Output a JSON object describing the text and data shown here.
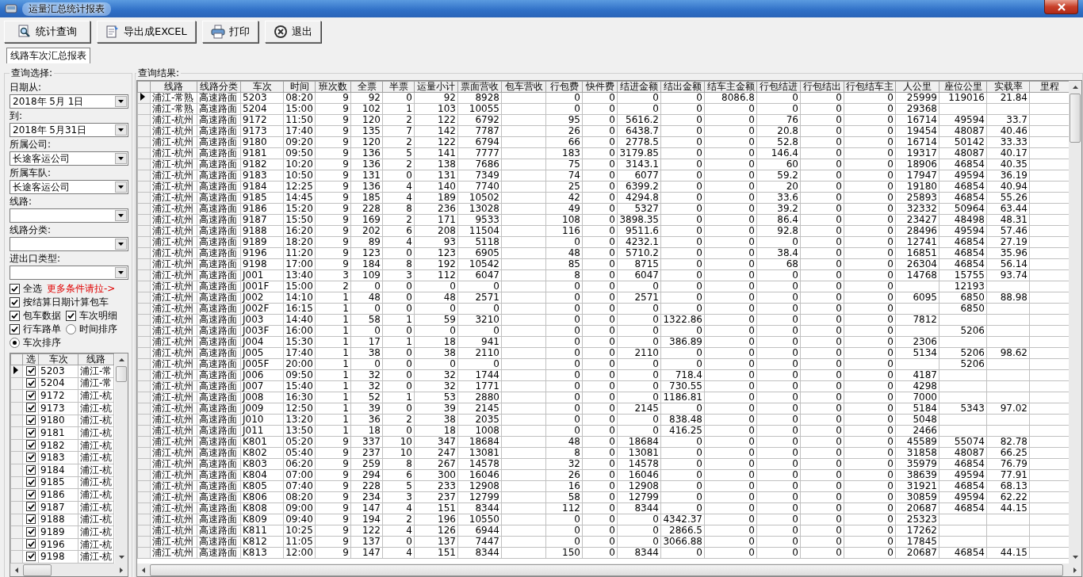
{
  "window": {
    "title": "运量汇总统计报表"
  },
  "toolbar": [
    {
      "kind": "query",
      "label": "统计查询"
    },
    {
      "kind": "export",
      "label": "导出成EXCEL"
    },
    {
      "kind": "print",
      "label": "打印"
    },
    {
      "kind": "exit",
      "label": "退出"
    }
  ],
  "tabs": [
    {
      "label": "线路车次汇总报表",
      "selected": true
    }
  ],
  "query_panel": {
    "title": "查询选择:",
    "fields": [
      {
        "label": "日期从:",
        "value": "2018年 5月 1日"
      },
      {
        "label": "到:",
        "value": "2018年 5月31日"
      },
      {
        "label": "所属公司:",
        "value": "长途客运公司"
      },
      {
        "label": "所属车队:",
        "value": "长途客运公司"
      },
      {
        "label": "线路:"
      },
      {
        "label": "线路分类:"
      },
      {
        "label": "进出口类型:"
      }
    ],
    "option_rows": [
      [
        {
          "kind": "checkbox",
          "label": "全选",
          "checked": true
        },
        {
          "kind": "link",
          "label": "更多条件请拉->"
        }
      ],
      [
        {
          "kind": "checkbox",
          "label": "按结算日期计算包车",
          "checked": true
        }
      ],
      [
        {
          "kind": "checkbox",
          "label": "包车数据",
          "checked": true
        },
        {
          "kind": "checkbox",
          "label": "车次明细",
          "checked": true
        }
      ],
      [
        {
          "kind": "checkbox",
          "label": "行车路单",
          "checked": true
        },
        {
          "kind": "radio",
          "label": "时间排序",
          "selected": false
        }
      ],
      [
        {
          "kind": "radio",
          "label": "车次排序",
          "selected": true
        }
      ]
    ],
    "list": {
      "columns": [
        "选",
        "车次",
        "线路"
      ],
      "rows": [
        {
          "selected": true,
          "checked": true,
          "train": "5203",
          "route": "浦江-常"
        },
        {
          "selected": false,
          "checked": true,
          "train": "5204",
          "route": "浦江-常"
        },
        {
          "selected": false,
          "checked": true,
          "train": "9172",
          "route": "浦江-杭"
        },
        {
          "selected": false,
          "checked": true,
          "train": "9173",
          "route": "浦江-杭"
        },
        {
          "selected": false,
          "checked": true,
          "train": "9180",
          "route": "浦江-杭"
        },
        {
          "selected": false,
          "checked": true,
          "train": "9181",
          "route": "浦江-杭"
        },
        {
          "selected": false,
          "checked": true,
          "train": "9182",
          "route": "浦江-杭"
        },
        {
          "selected": false,
          "checked": true,
          "train": "9183",
          "route": "浦江-杭"
        },
        {
          "selected": false,
          "checked": true,
          "train": "9184",
          "route": "浦江-杭"
        },
        {
          "selected": false,
          "checked": true,
          "train": "9185",
          "route": "浦江-杭"
        },
        {
          "selected": false,
          "checked": true,
          "train": "9186",
          "route": "浦江-杭"
        },
        {
          "selected": false,
          "checked": true,
          "train": "9187",
          "route": "浦江-杭"
        },
        {
          "selected": false,
          "checked": true,
          "train": "9188",
          "route": "浦江-杭"
        },
        {
          "selected": false,
          "checked": true,
          "train": "9189",
          "route": "浦江-杭"
        },
        {
          "selected": false,
          "checked": true,
          "train": "9196",
          "route": "浦江-杭"
        },
        {
          "selected": false,
          "checked": true,
          "train": "9198",
          "route": "浦江-杭"
        }
      ]
    }
  },
  "results": {
    "title": "查询结果:",
    "columns": [
      {
        "label": "线路",
        "kind": "text"
      },
      {
        "label": "线路分类",
        "kind": "text"
      },
      {
        "label": "车次",
        "kind": "text"
      },
      {
        "label": "时间",
        "kind": "time"
      },
      {
        "label": "班次数",
        "kind": "number"
      },
      {
        "label": "全票",
        "kind": "number"
      },
      {
        "label": "半票",
        "kind": "number"
      },
      {
        "label": "运量小计",
        "kind": "number"
      },
      {
        "label": "票面营收",
        "kind": "number"
      },
      {
        "label": "包车营收"
      },
      {
        "label": "行包费",
        "kind": "number"
      },
      {
        "label": "快件费",
        "kind": "number"
      },
      {
        "label": "结进金额",
        "kind": "number"
      },
      {
        "label": "结出金额",
        "kind": "number"
      },
      {
        "label": "结车主金额",
        "kind": "number"
      },
      {
        "label": "行包结进",
        "kind": "number"
      },
      {
        "label": "行包结出",
        "kind": "number"
      },
      {
        "label": "行包结车主",
        "kind": "number"
      },
      {
        "label": "人公里",
        "kind": "number"
      },
      {
        "label": "座位公里",
        "kind": "number"
      },
      {
        "label": "实载率",
        "kind": "number"
      },
      {
        "label": "里程"
      }
    ],
    "rows": [
      {
        "selected": true,
        "cells": [
          "浦江-常熟",
          "高速路面",
          "5203",
          "08:20",
          "9",
          "92",
          "0",
          "92",
          "8928",
          "",
          "0",
          "0",
          "0",
          "0",
          "8086.8",
          "0",
          "0",
          "0",
          "25999",
          "119016",
          "21.84",
          ""
        ]
      },
      {
        "selected": false,
        "cells": [
          "浦江-常熟",
          "高速路面",
          "5204",
          "15:00",
          "9",
          "102",
          "1",
          "103",
          "10055",
          "",
          "0",
          "0",
          "0",
          "0",
          "0",
          "0",
          "0",
          "0",
          "29368",
          "",
          "",
          ""
        ]
      },
      {
        "selected": false,
        "cells": [
          "浦江-杭州",
          "高速路面",
          "9172",
          "11:50",
          "9",
          "120",
          "2",
          "122",
          "6792",
          "",
          "95",
          "0",
          "5616.2",
          "0",
          "0",
          "76",
          "0",
          "0",
          "16714",
          "49594",
          "33.7",
          ""
        ]
      },
      {
        "selected": false,
        "cells": [
          "浦江-杭州",
          "高速路面",
          "9173",
          "17:40",
          "9",
          "135",
          "7",
          "142",
          "7787",
          "",
          "26",
          "0",
          "6438.7",
          "0",
          "0",
          "20.8",
          "0",
          "0",
          "19454",
          "48087",
          "40.46",
          ""
        ]
      },
      {
        "selected": false,
        "cells": [
          "浦江-杭州",
          "高速路面",
          "9180",
          "09:20",
          "9",
          "120",
          "2",
          "122",
          "6794",
          "",
          "66",
          "0",
          "2778.5",
          "0",
          "0",
          "52.8",
          "0",
          "0",
          "16714",
          "50142",
          "33.33",
          ""
        ]
      },
      {
        "selected": false,
        "cells": [
          "浦江-杭州",
          "高速路面",
          "9181",
          "09:50",
          "9",
          "136",
          "5",
          "141",
          "7777",
          "",
          "183",
          "0",
          "3179.85",
          "0",
          "0",
          "146.4",
          "0",
          "0",
          "19317",
          "48087",
          "40.17",
          ""
        ]
      },
      {
        "selected": false,
        "cells": [
          "浦江-杭州",
          "高速路面",
          "9182",
          "10:20",
          "9",
          "136",
          "2",
          "138",
          "7686",
          "",
          "75",
          "0",
          "3143.1",
          "0",
          "0",
          "60",
          "0",
          "0",
          "18906",
          "46854",
          "40.35",
          ""
        ]
      },
      {
        "selected": false,
        "cells": [
          "浦江-杭州",
          "高速路面",
          "9183",
          "10:50",
          "9",
          "131",
          "0",
          "131",
          "7349",
          "",
          "74",
          "0",
          "6077",
          "0",
          "0",
          "59.2",
          "0",
          "0",
          "17947",
          "49594",
          "36.19",
          ""
        ]
      },
      {
        "selected": false,
        "cells": [
          "浦江-杭州",
          "高速路面",
          "9184",
          "12:25",
          "9",
          "136",
          "4",
          "140",
          "7740",
          "",
          "25",
          "0",
          "6399.2",
          "0",
          "0",
          "20",
          "0",
          "0",
          "19180",
          "46854",
          "40.94",
          ""
        ]
      },
      {
        "selected": false,
        "cells": [
          "浦江-杭州",
          "高速路面",
          "9185",
          "14:45",
          "9",
          "185",
          "4",
          "189",
          "10502",
          "",
          "42",
          "0",
          "4294.8",
          "0",
          "0",
          "33.6",
          "0",
          "0",
          "25893",
          "46854",
          "55.26",
          ""
        ]
      },
      {
        "selected": false,
        "cells": [
          "浦江-杭州",
          "高速路面",
          "9186",
          "15:20",
          "9",
          "228",
          "8",
          "236",
          "13028",
          "",
          "49",
          "0",
          "5327",
          "0",
          "0",
          "39.2",
          "0",
          "0",
          "32332",
          "50964",
          "63.44",
          ""
        ]
      },
      {
        "selected": false,
        "cells": [
          "浦江-杭州",
          "高速路面",
          "9187",
          "15:50",
          "9",
          "169",
          "2",
          "171",
          "9533",
          "",
          "108",
          "0",
          "3898.35",
          "0",
          "0",
          "86.4",
          "0",
          "0",
          "23427",
          "48498",
          "48.31",
          ""
        ]
      },
      {
        "selected": false,
        "cells": [
          "浦江-杭州",
          "高速路面",
          "9188",
          "16:20",
          "9",
          "202",
          "6",
          "208",
          "11504",
          "",
          "116",
          "0",
          "9511.6",
          "0",
          "0",
          "92.8",
          "0",
          "0",
          "28496",
          "49594",
          "57.46",
          ""
        ]
      },
      {
        "selected": false,
        "cells": [
          "浦江-杭州",
          "高速路面",
          "9189",
          "18:20",
          "9",
          "89",
          "4",
          "93",
          "5118",
          "",
          "0",
          "0",
          "4232.1",
          "0",
          "0",
          "0",
          "0",
          "0",
          "12741",
          "46854",
          "27.19",
          ""
        ]
      },
      {
        "selected": false,
        "cells": [
          "浦江-杭州",
          "高速路面",
          "9196",
          "11:20",
          "9",
          "123",
          "0",
          "123",
          "6905",
          "",
          "48",
          "0",
          "5710.2",
          "0",
          "0",
          "38.4",
          "0",
          "0",
          "16851",
          "46854",
          "35.96",
          ""
        ]
      },
      {
        "selected": false,
        "cells": [
          "浦江-杭州",
          "高速路面",
          "9198",
          "17:00",
          "9",
          "184",
          "8",
          "192",
          "10542",
          "",
          "85",
          "0",
          "8715",
          "0",
          "0",
          "68",
          "0",
          "0",
          "26304",
          "46854",
          "56.14",
          ""
        ]
      },
      {
        "selected": false,
        "cells": [
          "浦江-杭州",
          "高速路面",
          "J001",
          "13:40",
          "3",
          "109",
          "3",
          "112",
          "6047",
          "",
          "8",
          "0",
          "6047",
          "0",
          "0",
          "0",
          "0",
          "0",
          "14768",
          "15755",
          "93.74",
          ""
        ]
      },
      {
        "selected": false,
        "cells": [
          "浦江-杭州",
          "高速路面",
          "J001F",
          "15:00",
          "2",
          "0",
          "0",
          "0",
          "0",
          "",
          "0",
          "0",
          "0",
          "0",
          "0",
          "0",
          "0",
          "0",
          "",
          "12193",
          "",
          ""
        ]
      },
      {
        "selected": false,
        "cells": [
          "浦江-杭州",
          "高速路面",
          "J002",
          "14:10",
          "1",
          "48",
          "0",
          "48",
          "2571",
          "",
          "0",
          "0",
          "2571",
          "0",
          "0",
          "0",
          "0",
          "0",
          "6095",
          "6850",
          "88.98",
          ""
        ]
      },
      {
        "selected": false,
        "cells": [
          "浦江-杭州",
          "高速路面",
          "J002F",
          "16:15",
          "1",
          "0",
          "0",
          "0",
          "0",
          "",
          "0",
          "0",
          "0",
          "0",
          "0",
          "0",
          "0",
          "0",
          "",
          "6850",
          "",
          ""
        ]
      },
      {
        "selected": false,
        "cells": [
          "浦江-杭州",
          "高速路面",
          "J003",
          "14:40",
          "1",
          "58",
          "1",
          "59",
          "3210",
          "",
          "0",
          "0",
          "0",
          "1322.86",
          "0",
          "0",
          "0",
          "0",
          "7812",
          "",
          "",
          ""
        ]
      },
      {
        "selected": false,
        "cells": [
          "浦江-杭州",
          "高速路面",
          "J003F",
          "16:00",
          "1",
          "0",
          "0",
          "0",
          "0",
          "",
          "0",
          "0",
          "0",
          "0",
          "0",
          "0",
          "0",
          "0",
          "",
          "5206",
          "",
          ""
        ]
      },
      {
        "selected": false,
        "cells": [
          "浦江-杭州",
          "高速路面",
          "J004",
          "15:30",
          "1",
          "17",
          "1",
          "18",
          "941",
          "",
          "0",
          "0",
          "0",
          "386.89",
          "0",
          "0",
          "0",
          "0",
          "2306",
          "",
          "",
          ""
        ]
      },
      {
        "selected": false,
        "cells": [
          "浦江-杭州",
          "高速路面",
          "J005",
          "17:40",
          "1",
          "38",
          "0",
          "38",
          "2110",
          "",
          "0",
          "0",
          "2110",
          "0",
          "0",
          "0",
          "0",
          "0",
          "5134",
          "5206",
          "98.62",
          ""
        ]
      },
      {
        "selected": false,
        "cells": [
          "浦江-杭州",
          "高速路面",
          "J005F",
          "20:00",
          "1",
          "0",
          "0",
          "0",
          "0",
          "",
          "0",
          "0",
          "0",
          "0",
          "0",
          "0",
          "0",
          "0",
          "",
          "5206",
          "",
          ""
        ]
      },
      {
        "selected": false,
        "cells": [
          "浦江-杭州",
          "高速路面",
          "J006",
          "09:50",
          "1",
          "32",
          "0",
          "32",
          "1744",
          "",
          "0",
          "0",
          "0",
          "718.4",
          "0",
          "0",
          "0",
          "0",
          "4187",
          "",
          "",
          ""
        ]
      },
      {
        "selected": false,
        "cells": [
          "浦江-杭州",
          "高速路面",
          "J007",
          "15:40",
          "1",
          "32",
          "0",
          "32",
          "1771",
          "",
          "0",
          "0",
          "0",
          "730.55",
          "0",
          "0",
          "0",
          "0",
          "4298",
          "",
          "",
          ""
        ]
      },
      {
        "selected": false,
        "cells": [
          "浦江-杭州",
          "高速路面",
          "J008",
          "16:30",
          "1",
          "52",
          "1",
          "53",
          "2880",
          "",
          "0",
          "0",
          "0",
          "1186.81",
          "0",
          "0",
          "0",
          "0",
          "7000",
          "",
          "",
          ""
        ]
      },
      {
        "selected": false,
        "cells": [
          "浦江-杭州",
          "高速路面",
          "J009",
          "12:50",
          "1",
          "39",
          "0",
          "39",
          "2145",
          "",
          "0",
          "0",
          "2145",
          "0",
          "0",
          "0",
          "0",
          "0",
          "5184",
          "5343",
          "97.02",
          ""
        ]
      },
      {
        "selected": false,
        "cells": [
          "浦江-杭州",
          "高速路面",
          "J010",
          "13:20",
          "1",
          "36",
          "2",
          "38",
          "2035",
          "",
          "0",
          "0",
          "0",
          "838.48",
          "0",
          "0",
          "0",
          "0",
          "5048",
          "",
          "",
          ""
        ]
      },
      {
        "selected": false,
        "cells": [
          "浦江-杭州",
          "高速路面",
          "J011",
          "13:50",
          "1",
          "18",
          "0",
          "18",
          "1008",
          "",
          "0",
          "0",
          "0",
          "416.25",
          "0",
          "0",
          "0",
          "0",
          "2466",
          "",
          "",
          ""
        ]
      },
      {
        "selected": false,
        "cells": [
          "浦江-杭州",
          "高速路面",
          "K801",
          "05:20",
          "9",
          "337",
          "10",
          "347",
          "18684",
          "",
          "48",
          "0",
          "18684",
          "0",
          "0",
          "0",
          "0",
          "0",
          "45589",
          "55074",
          "82.78",
          ""
        ]
      },
      {
        "selected": false,
        "cells": [
          "浦江-杭州",
          "高速路面",
          "K802",
          "05:40",
          "9",
          "237",
          "10",
          "247",
          "13081",
          "",
          "8",
          "0",
          "13081",
          "0",
          "0",
          "0",
          "0",
          "0",
          "31858",
          "48087",
          "66.25",
          ""
        ]
      },
      {
        "selected": false,
        "cells": [
          "浦江-杭州",
          "高速路面",
          "K803",
          "06:20",
          "9",
          "259",
          "8",
          "267",
          "14578",
          "",
          "32",
          "0",
          "14578",
          "0",
          "0",
          "0",
          "0",
          "0",
          "35979",
          "46854",
          "76.79",
          ""
        ]
      },
      {
        "selected": false,
        "cells": [
          "浦江-杭州",
          "高速路面",
          "K804",
          "07:00",
          "9",
          "294",
          "6",
          "300",
          "16046",
          "",
          "26",
          "0",
          "16046",
          "0",
          "0",
          "0",
          "0",
          "0",
          "38639",
          "49594",
          "77.91",
          ""
        ]
      },
      {
        "selected": false,
        "cells": [
          "浦江-杭州",
          "高速路面",
          "K805",
          "07:40",
          "9",
          "228",
          "5",
          "233",
          "12908",
          "",
          "16",
          "0",
          "12908",
          "0",
          "0",
          "0",
          "0",
          "0",
          "31921",
          "46854",
          "68.13",
          ""
        ]
      },
      {
        "selected": false,
        "cells": [
          "浦江-杭州",
          "高速路面",
          "K806",
          "08:20",
          "9",
          "234",
          "3",
          "237",
          "12799",
          "",
          "58",
          "0",
          "12799",
          "0",
          "0",
          "0",
          "0",
          "0",
          "30859",
          "49594",
          "62.22",
          ""
        ]
      },
      {
        "selected": false,
        "cells": [
          "浦江-杭州",
          "高速路面",
          "K808",
          "09:00",
          "9",
          "147",
          "4",
          "151",
          "8344",
          "",
          "112",
          "0",
          "8344",
          "0",
          "0",
          "0",
          "0",
          "0",
          "20687",
          "46854",
          "44.15",
          ""
        ]
      },
      {
        "selected": false,
        "cells": [
          "浦江-杭州",
          "高速路面",
          "K809",
          "09:40",
          "9",
          "194",
          "2",
          "196",
          "10550",
          "",
          "0",
          "0",
          "0",
          "4342.37",
          "0",
          "0",
          "0",
          "0",
          "25323",
          "",
          "",
          ""
        ]
      },
      {
        "selected": false,
        "cells": [
          "浦江-杭州",
          "高速路面",
          "K811",
          "10:25",
          "9",
          "122",
          "4",
          "126",
          "6944",
          "",
          "0",
          "0",
          "0",
          "2866.5",
          "0",
          "0",
          "0",
          "0",
          "17262",
          "",
          "",
          ""
        ]
      },
      {
        "selected": false,
        "cells": [
          "浦江-杭州",
          "高速路面",
          "K812",
          "11:05",
          "9",
          "137",
          "0",
          "137",
          "7447",
          "",
          "0",
          "0",
          "0",
          "3066.88",
          "0",
          "0",
          "0",
          "0",
          "17845",
          "",
          "",
          ""
        ]
      },
      {
        "selected": false,
        "cells": [
          "浦江-杭州",
          "高速路面",
          "K813",
          "12:00",
          "9",
          "147",
          "4",
          "151",
          "8344",
          "",
          "150",
          "0",
          "8344",
          "0",
          "0",
          "0",
          "0",
          "0",
          "20687",
          "46854",
          "44.15",
          ""
        ]
      }
    ]
  }
}
